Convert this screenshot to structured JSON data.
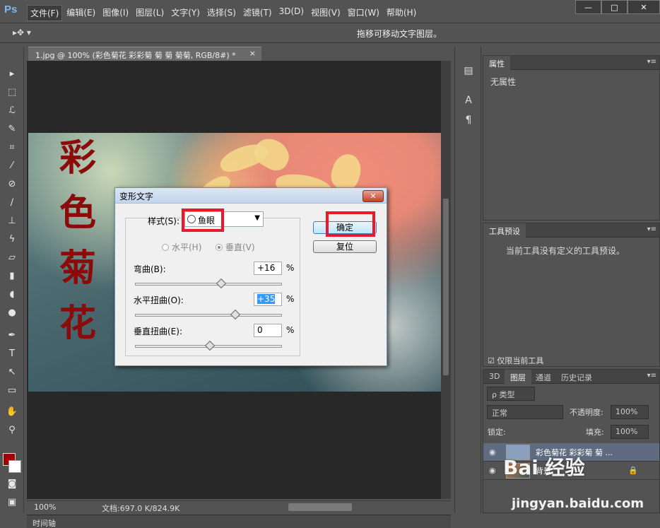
{
  "app": {
    "logo": "Ps"
  },
  "menu": [
    "文件(F)",
    "编辑(E)",
    "图像(I)",
    "图层(L)",
    "文字(Y)",
    "选择(S)",
    "滤镜(T)",
    "3D(D)",
    "视图(V)",
    "窗口(W)",
    "帮助(H)"
  ],
  "window_buttons": {
    "minimize": "—",
    "maximize": "□",
    "close": "✕"
  },
  "options_bar": {
    "tool_icon": "move-tool-icon",
    "hint": "拖移可移动文字图层。"
  },
  "document": {
    "tab_title": "1.jpg @ 100% (彩色菊花 彩彩菊 菊   菊 菊菊, RGB/8#) *",
    "tab_close": "×",
    "canvas_text": [
      "彩",
      "色",
      "菊",
      "花"
    ]
  },
  "dialog": {
    "title": "变形文字",
    "close": "✕",
    "style_label": "样式(S):",
    "style_value": "鱼眼",
    "orientation": {
      "horizontal": "水平(H)",
      "vertical": "垂直(V)",
      "selected": "vertical"
    },
    "bend_label": "弯曲(B):",
    "bend_value": "+16",
    "hdistort_label": "水平扭曲(O):",
    "hdistort_value": "+35",
    "vdistort_label": "垂直扭曲(E):",
    "vdistort_value": "0",
    "percent": "%",
    "ok_button": "确定",
    "reset_button": "复位",
    "slider_levels": {
      "bend": 16,
      "hdistort": 35,
      "vdistort": 0
    }
  },
  "statusbar": {
    "zoom": "100%",
    "doc_info": "文档:697.0 K/824.9K"
  },
  "timeline_label": "时间轴",
  "panels": {
    "properties": {
      "tab": "属性",
      "body": "无属性"
    },
    "tool_presets": {
      "tab": "工具预设",
      "body": "当前工具没有定义的工具预设。",
      "checkbox": "仅限当前工具"
    },
    "layers": {
      "tabs": [
        "3D",
        "图层",
        "通道",
        "历史记录"
      ],
      "filter": "ρ 类型",
      "blend_mode": "正常",
      "opacity_label": "不透明度:",
      "opacity_value": "100%",
      "lock_label": "锁定:",
      "fill_label": "填充:",
      "fill_value": "100%",
      "layers": [
        {
          "name": "彩色菊花 彩彩菊  菊 ...",
          "type": "text",
          "selected": true
        },
        {
          "name": "背景",
          "type": "image",
          "selected": false
        }
      ]
    }
  },
  "watermark": {
    "brand": "Bai 经验",
    "url": "jingyan.baidu.com"
  },
  "colors": {
    "foreground": "#a00000",
    "background": "#ffffff",
    "highlight_box": "#e8192c"
  }
}
